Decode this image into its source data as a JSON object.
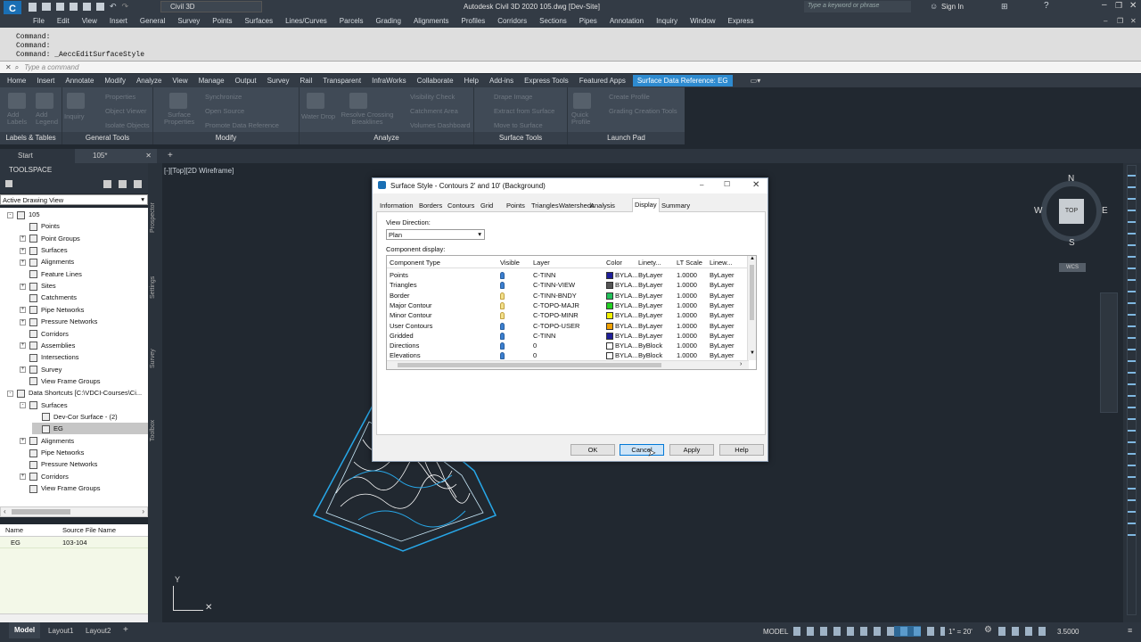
{
  "app": {
    "quick_access_label": "Civil 3D",
    "window_title": "Autodesk Civil 3D 2020   105.dwg [Dev-Site]",
    "search_placeholder": "Type a keyword or phrase",
    "sign_in": "Sign In"
  },
  "menus": [
    "File",
    "Edit",
    "View",
    "Insert",
    "General",
    "Survey",
    "Points",
    "Surfaces",
    "Lines/Curves",
    "Parcels",
    "Grading",
    "Alignments",
    "Profiles",
    "Corridors",
    "Sections",
    "Pipes",
    "Annotation",
    "Inquiry",
    "Window",
    "Express"
  ],
  "command": {
    "history": [
      "Command:",
      "Command:",
      "Command:  _AeccEditSurfaceStyle"
    ],
    "placeholder": "Type a command"
  },
  "ribbon_tabs": [
    "Home",
    "Insert",
    "Annotate",
    "Modify",
    "Analyze",
    "View",
    "Manage",
    "Output",
    "Survey",
    "Rail",
    "Transparent",
    "InfraWorks",
    "Collaborate",
    "Help",
    "Add-ins",
    "Express Tools",
    "Featured Apps",
    "Surface Data Reference: EG"
  ],
  "ribbon": {
    "panels": [
      "Labels & Tables",
      "General Tools",
      "Modify",
      "Analyze",
      "Surface Tools",
      "Launch Pad"
    ],
    "labels_tables": {
      "add_labels": "Add Labels",
      "add_legend": "Add Legend"
    },
    "general_tools": {
      "inquiry": "Inquiry",
      "properties": "Properties",
      "object_viewer": "Object Viewer",
      "isolate_objects": "Isolate Objects"
    },
    "modify": {
      "surface_properties": "Surface Properties",
      "synchronize": "Synchronize",
      "open_source": "Open Source",
      "promote": "Promote Data Reference"
    },
    "analyze": {
      "water_drop": "Water Drop",
      "resolve": "Resolve Crossing Breaklines",
      "visibility": "Visibility Check",
      "catchment": "Catchment Area",
      "volumes": "Volumes Dashboard"
    },
    "surface_tools": {
      "drape": "Drape Image",
      "extract": "Extract from Surface",
      "move": "Move to Surface"
    },
    "launch_pad": {
      "quick_profile": "Quick Profile",
      "create_profile": "Create Profile",
      "grading_tools": "Grading Creation Tools"
    }
  },
  "file_tabs": {
    "start": "Start",
    "doc": "105*"
  },
  "viewport_label": "[-][Top][2D Wireframe]",
  "viewcube": {
    "n": "N",
    "s": "S",
    "e": "E",
    "w": "W",
    "top": "TOP",
    "wcs": "WCS"
  },
  "toolspace": {
    "title": "TOOLSPACE",
    "view": "Active Drawing View",
    "side_tabs": [
      "Prospector",
      "Settings",
      "Survey",
      "Toolbox"
    ],
    "tree": [
      {
        "label": "105",
        "level": 0,
        "expander": "-"
      },
      {
        "label": "Points",
        "level": 1,
        "expander": ""
      },
      {
        "label": "Point Groups",
        "level": 1,
        "expander": "+"
      },
      {
        "label": "Surfaces",
        "level": 1,
        "expander": "+"
      },
      {
        "label": "Alignments",
        "level": 1,
        "expander": "+"
      },
      {
        "label": "Feature Lines",
        "level": 1,
        "expander": ""
      },
      {
        "label": "Sites",
        "level": 1,
        "expander": "+"
      },
      {
        "label": "Catchments",
        "level": 1,
        "expander": ""
      },
      {
        "label": "Pipe Networks",
        "level": 1,
        "expander": "+"
      },
      {
        "label": "Pressure Networks",
        "level": 1,
        "expander": "+"
      },
      {
        "label": "Corridors",
        "level": 1,
        "expander": ""
      },
      {
        "label": "Assemblies",
        "level": 1,
        "expander": "+"
      },
      {
        "label": "Intersections",
        "level": 1,
        "expander": ""
      },
      {
        "label": "Survey",
        "level": 1,
        "expander": "+"
      },
      {
        "label": "View Frame Groups",
        "level": 1,
        "expander": ""
      },
      {
        "label": "Data Shortcuts [C:\\VDCI-Courses\\Ci...",
        "level": 0,
        "expander": "-"
      },
      {
        "label": "Surfaces",
        "level": 1,
        "expander": "-"
      },
      {
        "label": "Dev-Cor Surface - (2)",
        "level": 2,
        "expander": ""
      },
      {
        "label": "EG",
        "level": 2,
        "expander": "",
        "selected": true
      },
      {
        "label": "Alignments",
        "level": 1,
        "expander": "+"
      },
      {
        "label": "Pipe Networks",
        "level": 1,
        "expander": ""
      },
      {
        "label": "Pressure Networks",
        "level": 1,
        "expander": ""
      },
      {
        "label": "Corridors",
        "level": 1,
        "expander": "+"
      },
      {
        "label": "View Frame Groups",
        "level": 1,
        "expander": ""
      }
    ],
    "list": {
      "headers": [
        "Name",
        "Source File Name"
      ],
      "rows": [
        [
          "EG",
          "103-104"
        ]
      ]
    }
  },
  "layout_tabs": [
    "Model",
    "Layout1",
    "Layout2"
  ],
  "status": {
    "model": "MODEL",
    "scale": "1\" = 20'",
    "value": "3.5000"
  },
  "dialog": {
    "title": "Surface Style - Contours 2' and 10' (Background)",
    "tabs": [
      "Information",
      "Borders",
      "Contours",
      "Grid",
      "Points",
      "Triangles",
      "Watersheds",
      "Analysis",
      "Display",
      "Summary"
    ],
    "active_tab": "Display",
    "view_direction_label": "View Direction:",
    "view_direction_value": "Plan",
    "component_display_label": "Component display:",
    "columns": [
      "Component Type",
      "Visible",
      "Layer",
      "Color",
      "Linety...",
      "LT Scale",
      "Linew..."
    ],
    "rows": [
      {
        "type": "Points",
        "visible": true,
        "layer": "C-TINN",
        "color": "#1e1e9a",
        "color_text": "BYLA...",
        "linetype": "ByLayer",
        "ltscale": "1.0000",
        "lineweight": "ByLayer"
      },
      {
        "type": "Triangles",
        "visible": true,
        "layer": "C-TINN-VIEW",
        "color": "#555555",
        "color_text": "BYLA...",
        "linetype": "ByLayer",
        "ltscale": "1.0000",
        "lineweight": "ByLayer"
      },
      {
        "type": "Border",
        "visible": false,
        "layer": "C-TINN-BNDY",
        "color": "#22c05a",
        "color_text": "BYLA...",
        "linetype": "ByLayer",
        "ltscale": "1.0000",
        "lineweight": "ByLayer"
      },
      {
        "type": "Major Contour",
        "visible": false,
        "layer": "C-TOPO-MAJR",
        "color": "#22d022",
        "color_text": "BYLA...",
        "linetype": "ByLayer",
        "ltscale": "1.0000",
        "lineweight": "ByLayer"
      },
      {
        "type": "Minor Contour",
        "visible": false,
        "layer": "C-TOPO-MINR",
        "color": "#f2f200",
        "color_text": "BYLA...",
        "linetype": "ByLayer",
        "ltscale": "1.0000",
        "lineweight": "ByLayer"
      },
      {
        "type": "User Contours",
        "visible": true,
        "layer": "C-TOPO-USER",
        "color": "#f0a000",
        "color_text": "BYLA...",
        "linetype": "ByLayer",
        "ltscale": "1.0000",
        "lineweight": "ByLayer"
      },
      {
        "type": "Gridded",
        "visible": true,
        "layer": "C-TINN",
        "color": "#1e1e9a",
        "color_text": "BYLA...",
        "linetype": "ByLayer",
        "ltscale": "1.0000",
        "lineweight": "ByLayer"
      },
      {
        "type": "Directions",
        "visible": true,
        "layer": "0",
        "color": "#ffffff",
        "color_text": "BYLA...",
        "linetype": "ByBlock",
        "ltscale": "1.0000",
        "lineweight": "ByLayer"
      },
      {
        "type": "Elevations",
        "visible": true,
        "layer": "0",
        "color": "#ffffff",
        "color_text": "BYLA...",
        "linetype": "ByBlock",
        "ltscale": "1.0000",
        "lineweight": "ByLayer"
      }
    ],
    "buttons": {
      "ok": "OK",
      "cancel": "Cancel",
      "apply": "Apply",
      "help": "Help"
    }
  }
}
